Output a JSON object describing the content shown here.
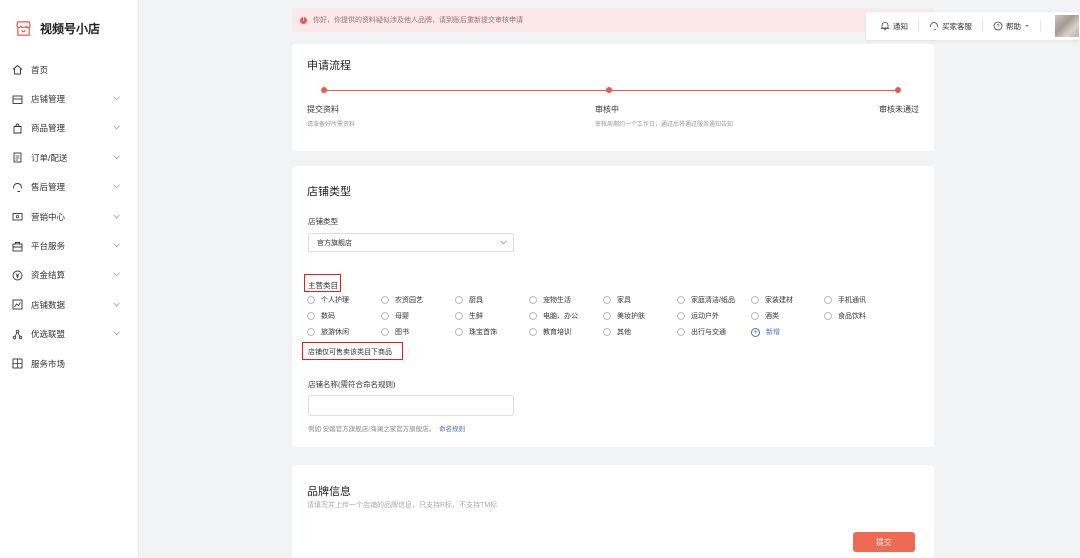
{
  "sidebar": {
    "brand": "视频号小店",
    "items": [
      {
        "label": "首页",
        "icon": "home-icon",
        "chevron": false
      },
      {
        "label": "店铺管理",
        "icon": "store-icon",
        "chevron": true
      },
      {
        "label": "商品管理",
        "icon": "bag-icon",
        "chevron": true
      },
      {
        "label": "订单/配送",
        "icon": "order-icon",
        "chevron": true
      },
      {
        "label": "售后管理",
        "icon": "headset-icon",
        "chevron": true
      },
      {
        "label": "营销中心",
        "icon": "marketing-icon",
        "chevron": true
      },
      {
        "label": "平台服务",
        "icon": "service-icon",
        "chevron": true
      },
      {
        "label": "资金结算",
        "icon": "yuan-icon",
        "chevron": true
      },
      {
        "label": "店铺数据",
        "icon": "chart-icon",
        "chevron": true
      },
      {
        "label": "优选联盟",
        "icon": "network-icon",
        "chevron": true
      },
      {
        "label": "服务市场",
        "icon": "market-icon",
        "chevron": false
      }
    ]
  },
  "topbar": {
    "notify": "通知",
    "service": "买家客服",
    "help": "帮助"
  },
  "alert": {
    "text": "你好，你提供的资料疑似涉及他人品牌，请到账后重新提交审核申请"
  },
  "process": {
    "title": "申请流程",
    "steps": [
      {
        "title": "提交资料",
        "desc": "请准备好所需资料"
      },
      {
        "title": "审核中",
        "desc": "审核周期约一个工作日，通过后将通过服务通知告知"
      },
      {
        "title": "审核未通过",
        "desc": ""
      }
    ]
  },
  "store_type": {
    "title": "店铺类型",
    "type_label": "店铺类型",
    "type_value": "官方旗舰店",
    "category_label": "主营类目",
    "categories": [
      [
        "个人护理",
        "农资园艺",
        "厨具",
        "宠物生活",
        "家具",
        "家庭清洁/纸品",
        "家装建材",
        "手机通讯"
      ],
      [
        "数码",
        "母婴",
        "生鲜",
        "电脑、办公",
        "美妆护肤",
        "运动户外",
        "酒类",
        "食品饮料"
      ],
      [
        "旅游休闲",
        "图书",
        "珠宝首饰",
        "教育培训",
        "其他",
        "出行与交通"
      ]
    ],
    "add_label": "新增",
    "hint": "店铺仅可售卖该类目下商品",
    "name_label": "店铺名称(需符合命名规则)",
    "name_value": "",
    "name_help": "例如 安踏官方旗舰店/海澜之家官方旗舰店。",
    "name_rule_link": "命名规则"
  },
  "brand_info": {
    "title": "品牌信息",
    "subtitle": "请填写并上传一个店铺的品牌信息，只支持R标，不支持TM标",
    "submit": "提交"
  },
  "colors": {
    "accent": "#e85a4f",
    "highlight": "#e02020",
    "link": "#4a72c4",
    "submit": "#ee6a55"
  }
}
